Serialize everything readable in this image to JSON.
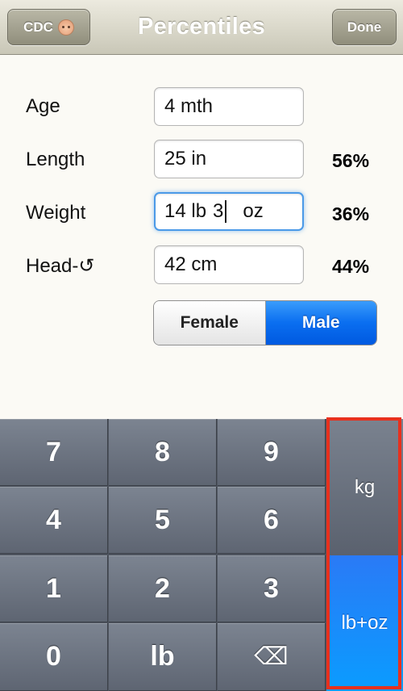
{
  "navbar": {
    "title": "Percentiles",
    "left_button_label": "CDC",
    "left_button_icon": "baby-face-icon",
    "right_button_label": "Done"
  },
  "form": {
    "rows": [
      {
        "label": "Age",
        "value": "4 mth",
        "percentile": ""
      },
      {
        "label": "Length",
        "value": "25 in",
        "percentile": "56%"
      },
      {
        "label": "Weight",
        "value_lb": "14 lb",
        "value_oz_num": "3",
        "value_oz_unit": "oz",
        "percentile": "36%"
      },
      {
        "label": "Head-↺",
        "value": "42 cm",
        "percentile": "44%"
      }
    ],
    "sex": {
      "options": [
        "Female",
        "Male"
      ],
      "selected": "Male"
    }
  },
  "keypad": {
    "keys": [
      "7",
      "8",
      "9",
      "4",
      "5",
      "6",
      "1",
      "2",
      "3",
      "0",
      "lb",
      "⌫"
    ],
    "unit_keys": [
      "kg",
      "lb+oz"
    ],
    "selected_unit": "lb+oz"
  },
  "colors": {
    "accent_blue": "#0a6ef0",
    "highlight_red": "#e8301d",
    "keypad_gray": "#5e6572"
  }
}
